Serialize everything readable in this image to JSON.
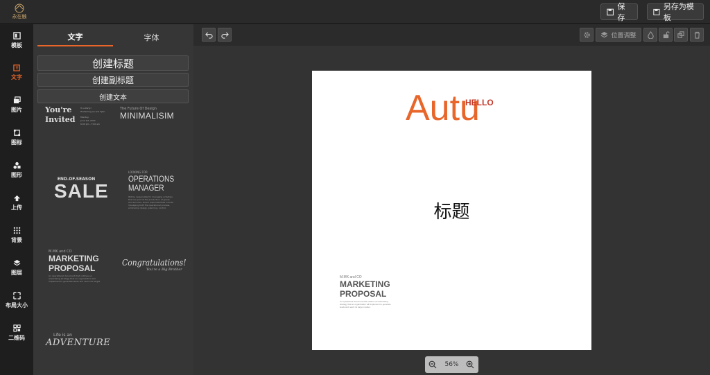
{
  "header": {
    "logo_text": "永在触",
    "save_label": "保存",
    "save_as_label": "另存为模板"
  },
  "nav": [
    {
      "label": "模板",
      "icon": "template-icon"
    },
    {
      "label": "文字",
      "icon": "text-icon",
      "active": true
    },
    {
      "label": "图片",
      "icon": "image-icon"
    },
    {
      "label": "图标",
      "icon": "icon-set-icon"
    },
    {
      "label": "图形",
      "icon": "shapes-icon"
    },
    {
      "label": "上传",
      "icon": "upload-icon"
    },
    {
      "label": "背景",
      "icon": "background-icon"
    },
    {
      "label": "图层",
      "icon": "layers-icon"
    },
    {
      "label": "布局大小",
      "icon": "resize-icon"
    },
    {
      "label": "二维码",
      "icon": "qrcode-icon"
    }
  ],
  "panel": {
    "tabs": [
      "文字",
      "字体"
    ],
    "create_title": "创建标题",
    "create_subtitle": "创建副标题",
    "create_text": "创建文本",
    "templates": {
      "invited": {
        "line1": "You're",
        "line2": "Invited",
        "side1": "To a Party!",
        "side2": "Hosted by Joe and Tyler",
        "side3": "Monday",
        "side4": "June 1st, 2022",
        "side5": "6:00 pm - 7:00 am"
      },
      "minimal": {
        "small": "The Future Of Design",
        "big": "MINIMALISIM"
      },
      "sale": {
        "small": "END.OF.SEASON",
        "big": "SALE"
      },
      "ops": {
        "small": "LOOKING FOR",
        "line1": "OPERATIONS",
        "line2": "MANAGER",
        "body": "Will be responsible for managing activities that are part of the production of goods and services. Direct responsibilities include managing both the operational process, embracing design, planning, control, performance improvement, and operations strategy."
      },
      "marketing": {
        "small": "M.MK and CO",
        "line1": "MARKETING",
        "line2": "PROPOSAL",
        "body": "An operational document that outlines an advertising strategy that an organization will implement to generate leads and reach its target market."
      },
      "congrats": {
        "line1": "Congratulations!",
        "line2": "You're a Big Brother"
      },
      "adventure": {
        "small": "Life is an",
        "big": "ADVENTURE"
      }
    }
  },
  "toolbar": {
    "position_label": "位置调整"
  },
  "canvas": {
    "autu": "Autu",
    "hello": "HELLO",
    "title": "标题",
    "mp_small": "M.MK and CO",
    "mp_line1": "MARKETING",
    "mp_line2": "PROPOSAL",
    "mp_body": "An operational document that outlines an advertising strategy that an organization will implement to generate leads and reach its target market."
  },
  "zoom": {
    "level": "56%"
  },
  "colors": {
    "accent": "#e8662a",
    "hello": "#c43a2a"
  }
}
